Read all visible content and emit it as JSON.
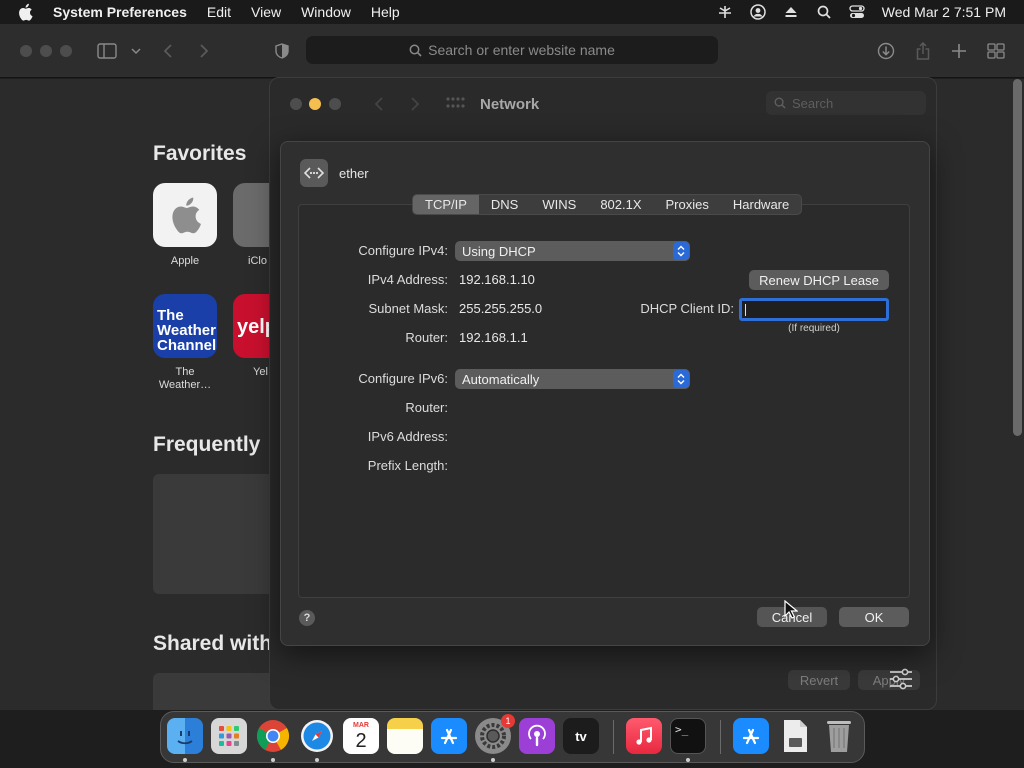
{
  "menubar": {
    "app": "System Preferences",
    "items": [
      "Edit",
      "View",
      "Window",
      "Help"
    ],
    "clock": "Wed Mar 2  7:51 PM"
  },
  "safari": {
    "url_placeholder": "Search or enter website name",
    "sections": {
      "favorites": "Favorites",
      "frequently": "Frequently",
      "shared": "Shared with"
    },
    "favorites": [
      {
        "label": "Apple"
      },
      {
        "label": "iClo"
      },
      {
        "label": "The Weather…",
        "tile_text": "The Weather Channel"
      },
      {
        "label": "Yel",
        "tile_text": "yelp"
      }
    ]
  },
  "network": {
    "title": "Network",
    "search_placeholder": "Search",
    "revert_label": "Revert",
    "apply_label": "Apply"
  },
  "sheet": {
    "interface": "ether",
    "tabs": [
      "TCP/IP",
      "DNS",
      "WINS",
      "802.1X",
      "Proxies",
      "Hardware"
    ],
    "selected_tab": "TCP/IP",
    "ipv4": {
      "configure_label": "Configure IPv4:",
      "configure_value": "Using DHCP",
      "address_label": "IPv4 Address:",
      "address_value": "192.168.1.10",
      "subnet_label": "Subnet Mask:",
      "subnet_value": "255.255.255.0",
      "router_label": "Router:",
      "router_value": "192.168.1.1"
    },
    "renew_label": "Renew DHCP Lease",
    "client_id_label": "DHCP Client ID:",
    "client_id_value": "",
    "client_id_hint": "(If required)",
    "ipv6": {
      "configure_label": "Configure IPv6:",
      "configure_value": "Automatically",
      "router_label": "Router:",
      "address_label": "IPv6 Address:",
      "prefix_label": "Prefix Length:"
    },
    "help_label": "?",
    "cancel_label": "Cancel",
    "ok_label": "OK"
  },
  "dock": {
    "calendar_month": "MAR",
    "calendar_day": "2",
    "settings_badge": "1",
    "tv_label": "tv",
    "terminal_prompt": ">_",
    "apps": [
      "finder",
      "launchpad",
      "chrome",
      "safari",
      "calendar",
      "notes",
      "app-store",
      "system-preferences",
      "podcasts",
      "apple-tv",
      "music",
      "terminal",
      "app-store-2",
      "archive",
      "trash"
    ]
  },
  "colors": {
    "accent": "#2d6fd6",
    "close": "#4d4d4d",
    "minimize": "#f5bf4f"
  }
}
